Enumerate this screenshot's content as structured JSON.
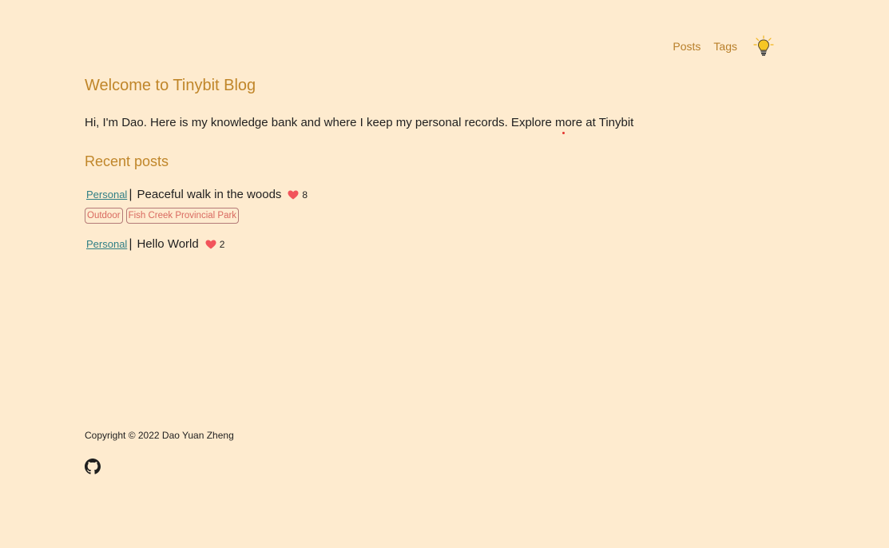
{
  "nav": {
    "links": [
      "Posts",
      "Tags"
    ],
    "theme_icon": "lightbulb-icon"
  },
  "home": {
    "title": "Welcome to Tinybit Blog",
    "intro_text": "Hi, I'm Dao. Here is my knowledge bank and where I keep my personal records. Explore more at ",
    "intro_link": "Tinybit",
    "recent_title": "Recent posts"
  },
  "posts": [
    {
      "category": "Personal",
      "title": "Peaceful walk in the woods",
      "likes": "8",
      "tags": [
        "Outdoor",
        "Fish Creek Provincial Park"
      ]
    },
    {
      "category": "Personal",
      "title": "Hello World",
      "likes": "2",
      "tags": []
    }
  ],
  "footer": {
    "copyright": "Copyright © 2022 Dao Yuan Zheng",
    "github_icon": "github-icon"
  },
  "colors": {
    "background": "#feebcf",
    "accent": "#c0862a",
    "category": "#2f7f86",
    "tag": "#d96a60",
    "heart": "#f2545b"
  }
}
